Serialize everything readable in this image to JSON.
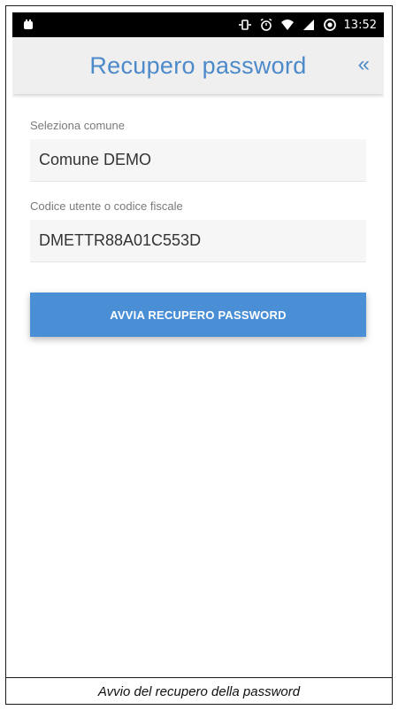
{
  "status_bar": {
    "time": "13:52",
    "icons": [
      "notification-icon",
      "sync-icon",
      "alarm-icon",
      "wifi-icon",
      "signal-icon",
      "battery-icon"
    ]
  },
  "app_bar": {
    "title": "Recupero password",
    "back_glyph": "«"
  },
  "form": {
    "comune_label": "Seleziona comune",
    "comune_value": "Comune DEMO",
    "codice_label": "Codice utente o codice fiscale",
    "codice_value": "DMETTR88A01C553D"
  },
  "actions": {
    "submit_label": "AVVIA RECUPERO PASSWORD"
  },
  "caption": "Avvio del recupero della password",
  "colors": {
    "accent": "#4d8ac9",
    "button": "#4a8fd6",
    "status_bar": "#000000",
    "app_bar": "#efefef"
  }
}
